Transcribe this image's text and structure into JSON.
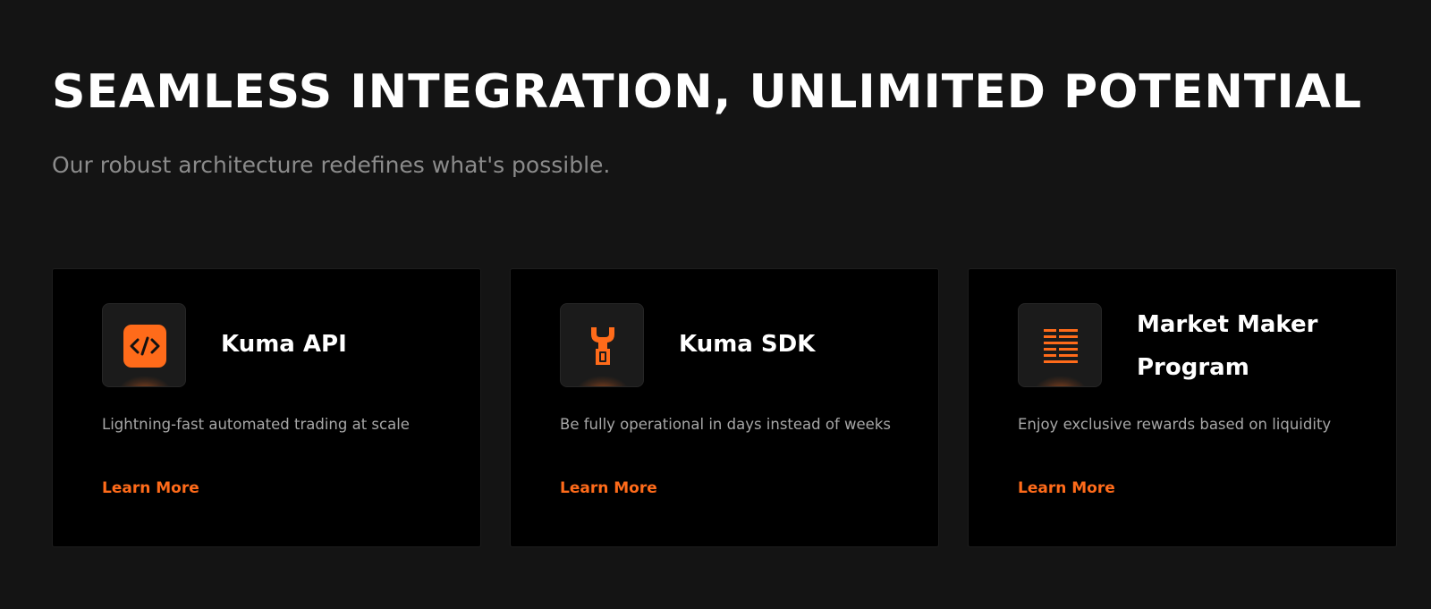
{
  "hero": {
    "title": "SEAMLESS INTEGRATION, UNLIMITED POTENTIAL",
    "subtitle": "Our robust architecture redefines what's possible."
  },
  "accent_color": "#ff6b1a",
  "cards": [
    {
      "icon": "code-icon",
      "title": "Kuma API",
      "description": "Lightning-fast automated trading at scale",
      "link_label": "Learn More"
    },
    {
      "icon": "wrench-icon",
      "title": "Kuma SDK",
      "description": "Be fully operational in days instead of weeks",
      "link_label": "Learn More"
    },
    {
      "icon": "order-book-icon",
      "title": "Market Maker Program",
      "description": "Enjoy exclusive rewards based on liquidity",
      "link_label": "Learn More"
    }
  ]
}
